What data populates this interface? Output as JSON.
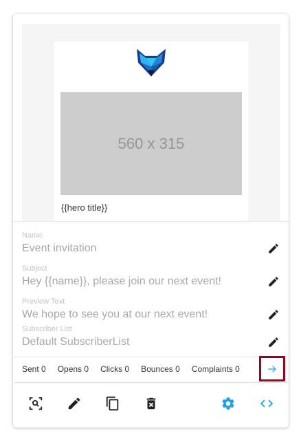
{
  "template": {
    "placeholder_size": "560 x 315",
    "hero_title": "{{hero title}}"
  },
  "fields": {
    "name": {
      "label": "Name",
      "value": "Event invitation"
    },
    "subject": {
      "label": "Subject",
      "value": "Hey {{name}}, please join our next event!"
    },
    "preview_text": {
      "label": "Preview Text",
      "value": "We hope to see you at our next event!"
    },
    "subscriber_list": {
      "label": "Subscriber List",
      "value": "Default SubscriberList"
    }
  },
  "stats": {
    "sent": "Sent 0",
    "opens": "Opens 0",
    "clicks": "Clicks 0",
    "bounces": "Bounces 0",
    "complaints": "Complaints 0"
  },
  "icons": {
    "edit": "pencil-icon",
    "details": "arrow-right-icon",
    "preview": "zoom-preview-icon",
    "duplicate": "copy-icon",
    "delete": "trash-icon",
    "settings": "gear-icon",
    "code": "code-icon"
  },
  "colors": {
    "accent": "#1fa0e8",
    "highlight_border": "#a4001c",
    "icon_dark": "#222222"
  }
}
